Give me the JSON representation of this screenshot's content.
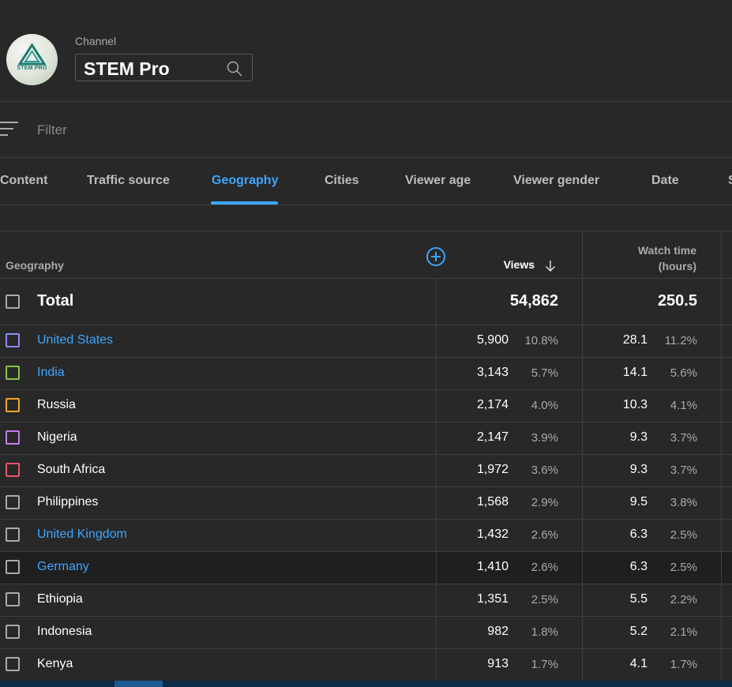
{
  "channel": {
    "label": "Channel",
    "name": "STEM Pro",
    "avatar_text": "STEM PRO",
    "brand_color": "#1f7a72"
  },
  "filter": {
    "placeholder": "Filter"
  },
  "tabs": [
    {
      "label": "Content",
      "active": false
    },
    {
      "label": "Traffic source",
      "active": false
    },
    {
      "label": "Geography",
      "active": true
    },
    {
      "label": "Cities",
      "active": false
    },
    {
      "label": "Viewer age",
      "active": false
    },
    {
      "label": "Viewer gender",
      "active": false
    },
    {
      "label": "Date",
      "active": false
    },
    {
      "label": "S",
      "active": false
    }
  ],
  "table": {
    "headers": {
      "geography": "Geography",
      "views": "Views",
      "watch_line1": "Watch time",
      "watch_line2": "(hours)"
    },
    "total": {
      "label": "Total",
      "views": "54,862",
      "watch": "250.5"
    },
    "rows": [
      {
        "name": "United States",
        "link": true,
        "checkbox_color": "#8c8cf5",
        "views": "5,900",
        "views_pct": "10.8%",
        "watch": "28.1",
        "watch_pct": "11.2%"
      },
      {
        "name": "India",
        "link": true,
        "checkbox_color": "#8bc34a",
        "views": "3,143",
        "views_pct": "5.7%",
        "watch": "14.1",
        "watch_pct": "5.6%"
      },
      {
        "name": "Russia",
        "link": false,
        "checkbox_color": "#f5a623",
        "views": "2,174",
        "views_pct": "4.0%",
        "watch": "10.3",
        "watch_pct": "4.1%"
      },
      {
        "name": "Nigeria",
        "link": false,
        "checkbox_color": "#c77dea",
        "views": "2,147",
        "views_pct": "3.9%",
        "watch": "9.3",
        "watch_pct": "3.7%"
      },
      {
        "name": "South Africa",
        "link": false,
        "checkbox_color": "#e8546e",
        "views": "1,972",
        "views_pct": "3.6%",
        "watch": "9.3",
        "watch_pct": "3.7%"
      },
      {
        "name": "Philippines",
        "link": false,
        "checkbox_color": "#aaaaaa",
        "views": "1,568",
        "views_pct": "2.9%",
        "watch": "9.5",
        "watch_pct": "3.8%"
      },
      {
        "name": "United Kingdom",
        "link": true,
        "checkbox_color": "#aaaaaa",
        "views": "1,432",
        "views_pct": "2.6%",
        "watch": "6.3",
        "watch_pct": "2.5%"
      },
      {
        "name": "Germany",
        "link": true,
        "checkbox_color": "#aaaaaa",
        "views": "1,410",
        "views_pct": "2.6%",
        "watch": "6.3",
        "watch_pct": "2.5%",
        "hover": true
      },
      {
        "name": "Ethiopia",
        "link": false,
        "checkbox_color": "#aaaaaa",
        "views": "1,351",
        "views_pct": "2.5%",
        "watch": "5.5",
        "watch_pct": "2.2%"
      },
      {
        "name": "Indonesia",
        "link": false,
        "checkbox_color": "#aaaaaa",
        "views": "982",
        "views_pct": "1.8%",
        "watch": "5.2",
        "watch_pct": "2.1%"
      },
      {
        "name": "Kenya",
        "link": false,
        "checkbox_color": "#aaaaaa",
        "views": "913",
        "views_pct": "1.7%",
        "watch": "4.1",
        "watch_pct": "1.7%"
      }
    ]
  },
  "colors": {
    "background": "#282828",
    "accent": "#3ea6ff",
    "border": "#3e3e3e"
  }
}
